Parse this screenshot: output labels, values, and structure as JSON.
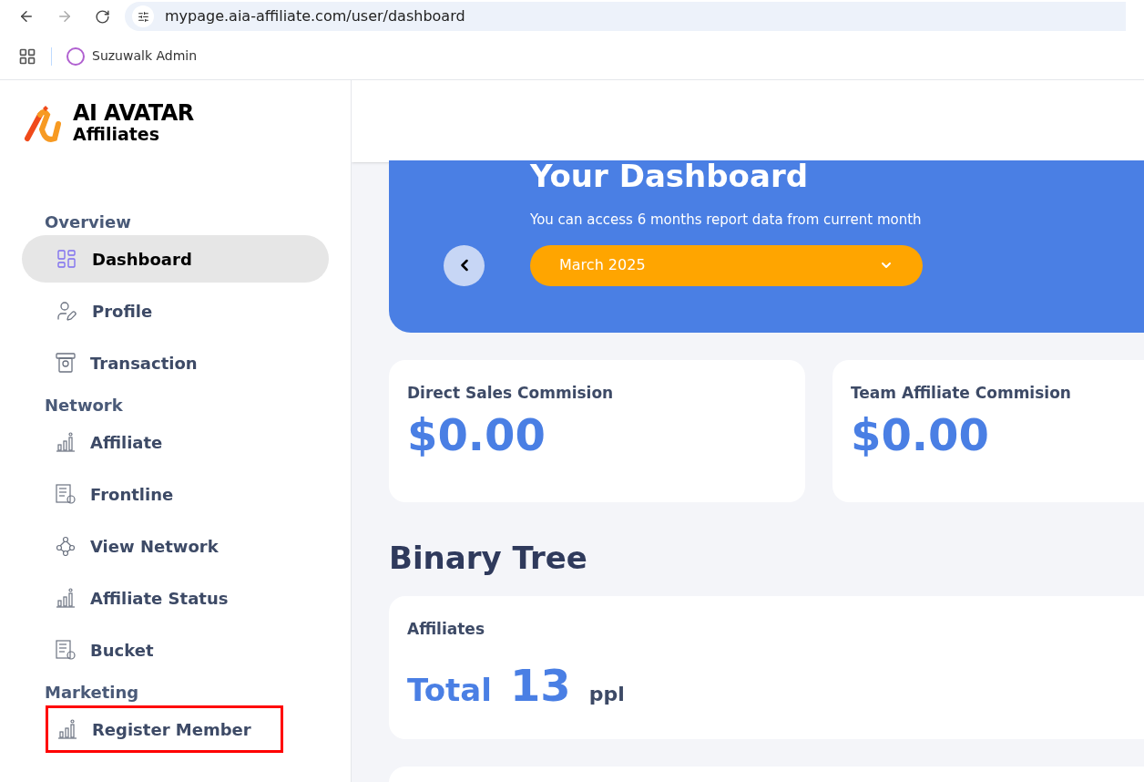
{
  "browser": {
    "url": "mypage.aia-affiliate.com/user/dashboard",
    "bookmarks": [
      {
        "label": "Suzuwalk Admin"
      }
    ]
  },
  "logo": {
    "title": "AI AVATAR",
    "subtitle": "Affiliates"
  },
  "sidebar": {
    "sections": [
      {
        "title": "Overview",
        "items": [
          {
            "label": "Dashboard",
            "kind": "grid",
            "selected": true,
            "highlighted": false
          },
          {
            "label": "Profile",
            "kind": "user",
            "selected": false,
            "highlighted": false
          },
          {
            "label": "Transaction",
            "kind": "atm",
            "selected": false,
            "highlighted": false
          }
        ]
      },
      {
        "title": "Network",
        "items": [
          {
            "label": "Affiliate",
            "kind": "bars",
            "selected": false,
            "highlighted": false
          },
          {
            "label": "Frontline",
            "kind": "list",
            "selected": false,
            "highlighted": false
          },
          {
            "label": "View Network",
            "kind": "network",
            "selected": false,
            "highlighted": false
          },
          {
            "label": "Affiliate Status",
            "kind": "bars",
            "selected": false,
            "highlighted": false
          },
          {
            "label": "Bucket",
            "kind": "list",
            "selected": false,
            "highlighted": false
          }
        ]
      },
      {
        "title": "Marketing",
        "items": [
          {
            "label": "Register Member",
            "kind": "bars",
            "selected": false,
            "highlighted": true
          }
        ]
      }
    ]
  },
  "banner": {
    "title": "Your Dashboard",
    "subtitle": "You can access 6 months report data from current month",
    "month": "March 2025"
  },
  "commissions": [
    {
      "label": "Direct Sales Commision",
      "value": "$0.00"
    },
    {
      "label": "Team Affiliate Commision",
      "value": "$0.00"
    }
  ],
  "binary_tree": {
    "title": "Binary Tree",
    "card": {
      "label": "Affiliates",
      "prefix": "Total",
      "count": "13",
      "unit": "ppl"
    }
  }
}
